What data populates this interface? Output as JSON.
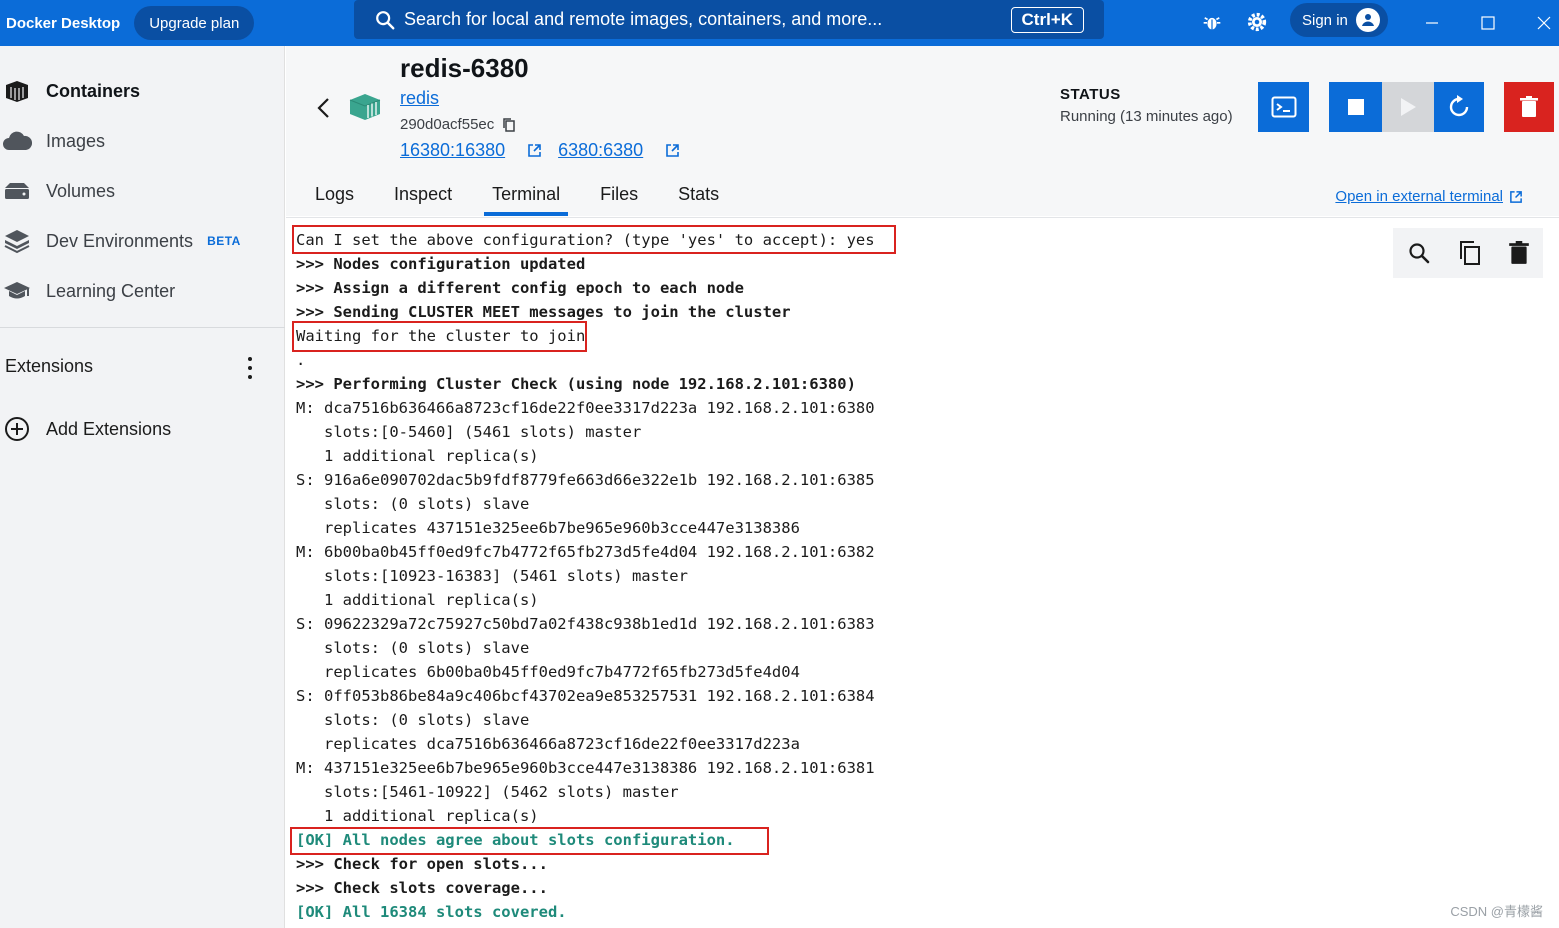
{
  "topbar": {
    "brand": "Docker Desktop",
    "upgrade_label": "Upgrade plan",
    "search_placeholder": "Search for local and remote images, containers, and more...",
    "shortcut": "Ctrl+K",
    "signin_label": "Sign in"
  },
  "sidebar": {
    "items": [
      {
        "label": "Containers",
        "icon": "containers-icon",
        "active": true
      },
      {
        "label": "Images",
        "icon": "images-icon"
      },
      {
        "label": "Volumes",
        "icon": "volumes-icon"
      },
      {
        "label": "Dev Environments",
        "icon": "dev-environments-icon",
        "badge": "BETA"
      },
      {
        "label": "Learning Center",
        "icon": "learning-center-icon"
      }
    ],
    "extensions_title": "Extensions",
    "add_extensions_label": "Add Extensions"
  },
  "container": {
    "name": "redis-6380",
    "image": "redis",
    "id": "290d0acf55ec",
    "ports": [
      "16380:16380",
      "6380:6380"
    ],
    "status_label": "STATUS",
    "status_value": "Running (13 minutes ago)"
  },
  "tabs": [
    "Logs",
    "Inspect",
    "Terminal",
    "Files",
    "Stats"
  ],
  "active_tab": "Terminal",
  "open_external_label": "Open in external terminal",
  "terminal": {
    "lines": [
      {
        "text": "Can I set the above configuration? (type 'yes' to accept): yes",
        "style": ""
      },
      {
        "text": ">>> Nodes configuration updated",
        "style": "b"
      },
      {
        "text": ">>> Assign a different config epoch to each node",
        "style": "b"
      },
      {
        "text": ">>> Sending CLUSTER MEET messages to join the cluster",
        "style": "b"
      },
      {
        "text": "Waiting for the cluster to join",
        "style": ""
      },
      {
        "text": ".",
        "style": ""
      },
      {
        "text": ">>> Performing Cluster Check (using node 192.168.2.101:6380)",
        "style": "b"
      },
      {
        "text": "M: dca7516b636466a8723cf16de22f0ee3317d223a 192.168.2.101:6380",
        "style": ""
      },
      {
        "text": "   slots:[0-5460] (5461 slots) master",
        "style": ""
      },
      {
        "text": "   1 additional replica(s)",
        "style": ""
      },
      {
        "text": "S: 916a6e090702dac5b9fdf8779fe663d66e322e1b 192.168.2.101:6385",
        "style": ""
      },
      {
        "text": "   slots: (0 slots) slave",
        "style": ""
      },
      {
        "text": "   replicates 437151e325ee6b7be965e960b3cce447e3138386",
        "style": ""
      },
      {
        "text": "M: 6b00ba0b45ff0ed9fc7b4772f65fb273d5fe4d04 192.168.2.101:6382",
        "style": ""
      },
      {
        "text": "   slots:[10923-16383] (5461 slots) master",
        "style": ""
      },
      {
        "text": "   1 additional replica(s)",
        "style": ""
      },
      {
        "text": "S: 09622329a72c75927c50bd7a02f438c938b1ed1d 192.168.2.101:6383",
        "style": ""
      },
      {
        "text": "   slots: (0 slots) slave",
        "style": ""
      },
      {
        "text": "   replicates 6b00ba0b45ff0ed9fc7b4772f65fb273d5fe4d04",
        "style": ""
      },
      {
        "text": "S: 0ff053b86be84a9c406bcf43702ea9e853257531 192.168.2.101:6384",
        "style": ""
      },
      {
        "text": "   slots: (0 slots) slave",
        "style": ""
      },
      {
        "text": "   replicates dca7516b636466a8723cf16de22f0ee3317d223a",
        "style": ""
      },
      {
        "text": "M: 437151e325ee6b7be965e960b3cce447e3138386 192.168.2.101:6381",
        "style": ""
      },
      {
        "text": "   slots:[5461-10922] (5462 slots) master",
        "style": ""
      },
      {
        "text": "   1 additional replica(s)",
        "style": ""
      },
      {
        "text": "[OK] All nodes agree about slots configuration.",
        "style": "ok"
      },
      {
        "text": ">>> Check for open slots...",
        "style": "b"
      },
      {
        "text": ">>> Check slots coverage...",
        "style": "b"
      },
      {
        "text": "[OK] All 16384 slots covered.",
        "style": "ok"
      }
    ]
  },
  "watermark": "CSDN @青檬酱",
  "colors": {
    "accent": "#0b6cd8",
    "danger": "#d9231f",
    "ok": "#1e8a7a",
    "highlight": "#d9231f"
  }
}
